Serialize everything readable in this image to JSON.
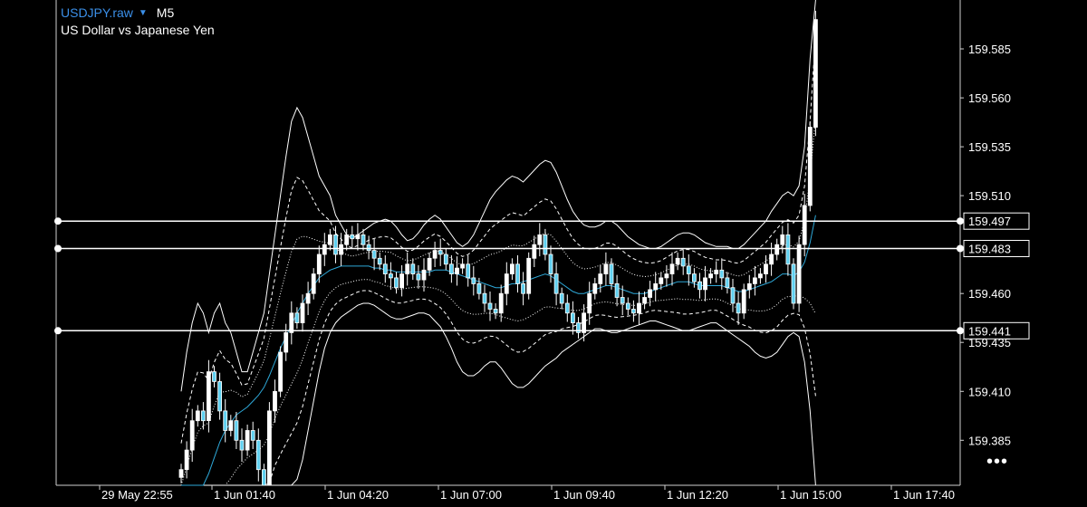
{
  "header": {
    "symbol": "USDJPY.raw",
    "timeframe": "M5",
    "description": "US Dollar vs Japanese Yen"
  },
  "more_button": {
    "label": "•••"
  },
  "colors": {
    "background": "#000000",
    "candle": "#ffffff",
    "candle_down_fill": "#5fd0f0",
    "moving_average": "#2ea8d8",
    "bands": "#ffffff",
    "symbol": "#3b8fe8"
  },
  "chart_data": {
    "type": "candlestick",
    "ylim": [
      159.362,
      159.61
    ],
    "y_ticks": [
      159.585,
      159.56,
      159.535,
      159.51,
      159.46,
      159.435,
      159.41,
      159.385
    ],
    "x_tick_labels": [
      "29 May 22:55",
      "1 Jun 01:40",
      "1 Jun 04:20",
      "1 Jun 07:00",
      "1 Jun 09:40",
      "1 Jun 12:20",
      "1 Jun 15:00",
      "1 Jun 17:40"
    ],
    "horizontal_lines": [
      159.497,
      159.483,
      159.441
    ],
    "candle_count": 116,
    "last_candle_index": 115,
    "close": [
      159.37,
      159.38,
      159.395,
      159.4,
      159.395,
      159.42,
      159.415,
      159.4,
      159.39,
      159.395,
      159.385,
      159.38,
      159.39,
      159.385,
      159.37,
      159.36,
      159.4,
      159.41,
      159.43,
      159.44,
      159.45,
      159.445,
      159.455,
      159.46,
      159.47,
      159.48,
      159.485,
      159.49,
      159.48,
      159.485,
      159.49,
      159.488,
      159.49,
      159.485,
      159.482,
      159.478,
      159.475,
      159.47,
      159.468,
      159.463,
      159.47,
      159.475,
      159.47,
      159.467,
      159.472,
      159.478,
      159.482,
      159.48,
      159.475,
      159.47,
      159.473,
      159.475,
      159.468,
      159.465,
      159.46,
      159.455,
      159.452,
      159.45,
      159.46,
      159.47,
      159.475,
      159.465,
      159.46,
      159.478,
      159.485,
      159.49,
      159.48,
      159.47,
      159.46,
      159.455,
      159.45,
      159.445,
      159.44,
      159.45,
      159.46,
      159.465,
      159.47,
      159.475,
      159.465,
      159.458,
      159.455,
      159.452,
      159.45,
      159.455,
      159.458,
      159.462,
      159.465,
      159.468,
      159.47,
      159.475,
      159.478,
      159.474,
      159.47,
      159.466,
      159.462,
      159.468,
      159.47,
      159.472,
      159.468,
      159.463,
      159.455,
      159.45,
      159.462,
      159.465,
      159.468,
      159.47,
      159.475,
      159.48,
      159.485,
      159.49,
      159.475,
      159.455,
      159.485,
      159.505,
      159.545,
      159.6
    ],
    "moving_average": [
      159.332,
      159.338,
      159.345,
      159.352,
      159.36,
      159.368,
      159.376,
      159.384,
      159.39,
      159.394,
      159.398,
      159.4,
      159.402,
      159.405,
      159.408,
      159.412,
      159.418,
      159.425,
      159.432,
      159.438,
      159.444,
      159.45,
      159.455,
      159.46,
      159.464,
      159.468,
      159.47,
      159.472,
      159.473,
      159.474,
      159.474,
      159.474,
      159.474,
      159.474,
      159.474,
      159.473,
      159.473,
      159.472,
      159.472,
      159.471,
      159.471,
      159.471,
      159.471,
      159.471,
      159.471,
      159.471,
      159.472,
      159.472,
      159.472,
      159.471,
      159.47,
      159.469,
      159.468,
      159.467,
      159.466,
      159.465,
      159.464,
      159.463,
      159.463,
      159.464,
      159.465,
      159.465,
      159.466,
      159.467,
      159.468,
      159.469,
      159.47,
      159.469,
      159.467,
      159.465,
      159.463,
      159.461,
      159.46,
      159.46,
      159.461,
      159.462,
      159.463,
      159.464,
      159.464,
      159.463,
      159.462,
      159.461,
      159.46,
      159.46,
      159.46,
      159.461,
      159.462,
      159.463,
      159.464,
      159.465,
      159.466,
      159.466,
      159.466,
      159.465,
      159.464,
      159.464,
      159.464,
      159.464,
      159.464,
      159.463,
      159.462,
      159.461,
      159.461,
      159.462,
      159.463,
      159.464,
      159.465,
      159.466,
      159.468,
      159.47,
      159.47,
      159.469,
      159.471,
      159.476,
      159.486,
      159.5
    ],
    "band_outer_upper": [
      159.41,
      159.43,
      159.445,
      159.455,
      159.45,
      159.44,
      159.45,
      159.455,
      159.445,
      159.44,
      159.43,
      159.42,
      159.42,
      159.43,
      159.44,
      159.45,
      159.47,
      159.49,
      159.51,
      159.53,
      159.548,
      159.555,
      159.55,
      159.54,
      159.53,
      159.52,
      159.515,
      159.51,
      159.5,
      159.495,
      159.49,
      159.488,
      159.49,
      159.492,
      159.494,
      159.496,
      159.497,
      159.498,
      159.497,
      159.494,
      159.49,
      159.487,
      159.488,
      159.491,
      159.495,
      159.498,
      159.5,
      159.498,
      159.494,
      159.49,
      159.486,
      159.484,
      159.486,
      159.49,
      159.496,
      159.502,
      159.508,
      159.512,
      159.515,
      159.518,
      159.52,
      159.519,
      159.517,
      159.52,
      159.523,
      159.526,
      159.528,
      159.527,
      159.522,
      159.515,
      159.508,
      159.502,
      159.498,
      159.495,
      159.494,
      159.494,
      159.495,
      159.497,
      159.497,
      159.495,
      159.492,
      159.489,
      159.487,
      159.485,
      159.484,
      159.483,
      159.483,
      159.484,
      159.486,
      159.488,
      159.49,
      159.491,
      159.491,
      159.49,
      159.488,
      159.486,
      159.485,
      159.484,
      159.484,
      159.484,
      159.483,
      159.483,
      159.485,
      159.488,
      159.491,
      159.494,
      159.497,
      159.502,
      159.506,
      159.51,
      159.512,
      159.51,
      159.515,
      159.535,
      159.58,
      159.64
    ],
    "band_outer_lower": [
      159.255,
      159.25,
      159.26,
      159.27,
      159.28,
      159.29,
      159.3,
      159.305,
      159.31,
      159.315,
      159.32,
      159.325,
      159.33,
      159.33,
      159.33,
      159.33,
      159.335,
      159.345,
      159.35,
      159.355,
      159.36,
      159.365,
      159.375,
      159.39,
      159.405,
      159.42,
      159.432,
      159.44,
      159.445,
      159.448,
      159.45,
      159.452,
      159.454,
      159.455,
      159.455,
      159.454,
      159.452,
      159.45,
      159.448,
      159.447,
      159.447,
      159.448,
      159.449,
      159.45,
      159.45,
      159.449,
      159.446,
      159.443,
      159.438,
      159.432,
      159.425,
      159.42,
      159.418,
      159.418,
      159.42,
      159.423,
      159.425,
      159.425,
      159.422,
      159.418,
      159.414,
      159.412,
      159.412,
      159.414,
      159.417,
      159.42,
      159.423,
      159.425,
      159.427,
      159.43,
      159.432,
      159.434,
      159.436,
      159.438,
      159.44,
      159.442,
      159.442,
      159.441,
      159.44,
      159.44,
      159.441,
      159.442,
      159.443,
      159.444,
      159.445,
      159.446,
      159.446,
      159.445,
      159.444,
      159.443,
      159.442,
      159.441,
      159.441,
      159.442,
      159.443,
      159.444,
      159.445,
      159.445,
      159.443,
      159.441,
      159.439,
      159.437,
      159.435,
      159.433,
      159.43,
      159.428,
      159.427,
      159.428,
      159.43,
      159.434,
      159.438,
      159.44,
      159.438,
      159.425,
      159.4,
      159.36
    ]
  }
}
